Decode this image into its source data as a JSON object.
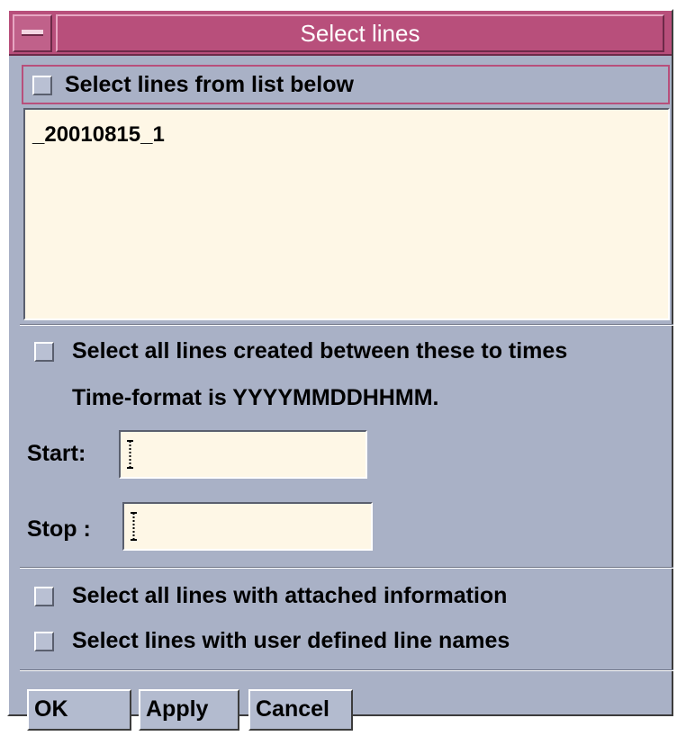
{
  "window": {
    "title": "Select lines"
  },
  "list_section": {
    "checkbox_label": "Select lines from list below",
    "items": [
      "_20010815_1"
    ]
  },
  "time_section": {
    "checkbox_label": "Select all lines created between these to times",
    "format_note": "Time-format is YYYYMMDDHHMM.",
    "start_label": "Start:",
    "start_value": "",
    "stop_label": "Stop :",
    "stop_value": ""
  },
  "options": {
    "attached_info_label": "Select all lines with attached information",
    "user_defined_label": "Select lines with user defined line names"
  },
  "buttons": {
    "ok": "OK",
    "apply": "Apply",
    "cancel": "Cancel"
  },
  "colors": {
    "title_bar": "#b84f7b",
    "window_bg": "#a9b1c6",
    "field_bg": "#fef7e6"
  }
}
